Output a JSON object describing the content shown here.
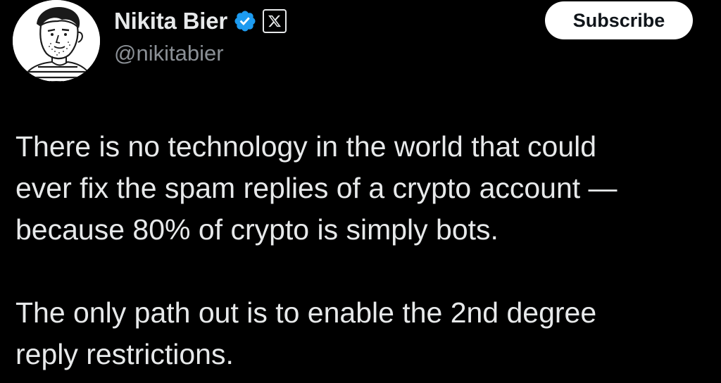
{
  "author": {
    "display_name": "Nikita Bier",
    "handle": "@nikitabier",
    "verified": true,
    "affiliation_icon": "x-logo-icon",
    "avatar_icon": "sketched-portrait-avatar"
  },
  "actions": {
    "subscribe_label": "Subscribe"
  },
  "tweet": {
    "paragraphs": [
      {
        "lines": [
          "There is no technology in the world that could",
          "ever fix the spam replies of a crypto account —",
          "because 80% of crypto is simply bots."
        ]
      },
      {
        "lines": [
          "The only path out is to enable the 2nd degree",
          "reply restrictions."
        ]
      }
    ]
  },
  "colors": {
    "background": "#000000",
    "text_primary": "#e7e9ea",
    "text_secondary": "#8b9096",
    "verified_blue": "#1d9bf0",
    "button_bg": "#ffffff",
    "button_text": "#0f1419"
  }
}
